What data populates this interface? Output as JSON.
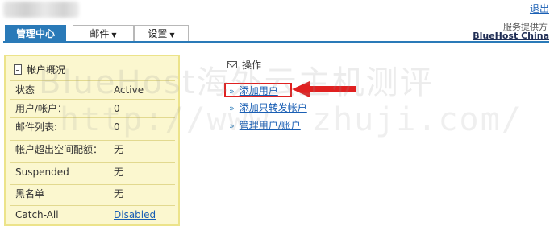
{
  "header": {
    "logout_label": "退出",
    "provider_label": "服务提供方",
    "provider_name": "BlueHost China"
  },
  "tabs": [
    {
      "label": "管理中心",
      "active": true
    },
    {
      "label": "邮件",
      "dropdown": true
    },
    {
      "label": "设置",
      "dropdown": true
    }
  ],
  "account_overview": {
    "title": "帐户概况",
    "rows": [
      {
        "label": "状态",
        "value": "Active"
      },
      {
        "label": "用户/帐户：",
        "value": "0"
      },
      {
        "label": "邮件列表:",
        "value": "0"
      },
      {
        "label": "帐户超出空间配额：",
        "value": "无"
      },
      {
        "label": "Suspended",
        "value": "无"
      },
      {
        "label": "黑名单",
        "value": "无"
      },
      {
        "label": "Catch-All",
        "value": "Disabled",
        "link": true
      }
    ]
  },
  "operations": {
    "title": "操作",
    "items": [
      {
        "label": "添加用户",
        "highlighted": true
      },
      {
        "label": "添加只转发帐户"
      },
      {
        "label": "管理用户/账户"
      }
    ]
  },
  "watermark": {
    "line1": "BlueHost海外云主机测评",
    "line2": "http://www.      zhuji.com/"
  },
  "colors": {
    "tab_active": "#2a7ab8",
    "panel_bg": "#fbf7cf",
    "highlight_red": "#e02020",
    "link": "#1a5fb4"
  }
}
